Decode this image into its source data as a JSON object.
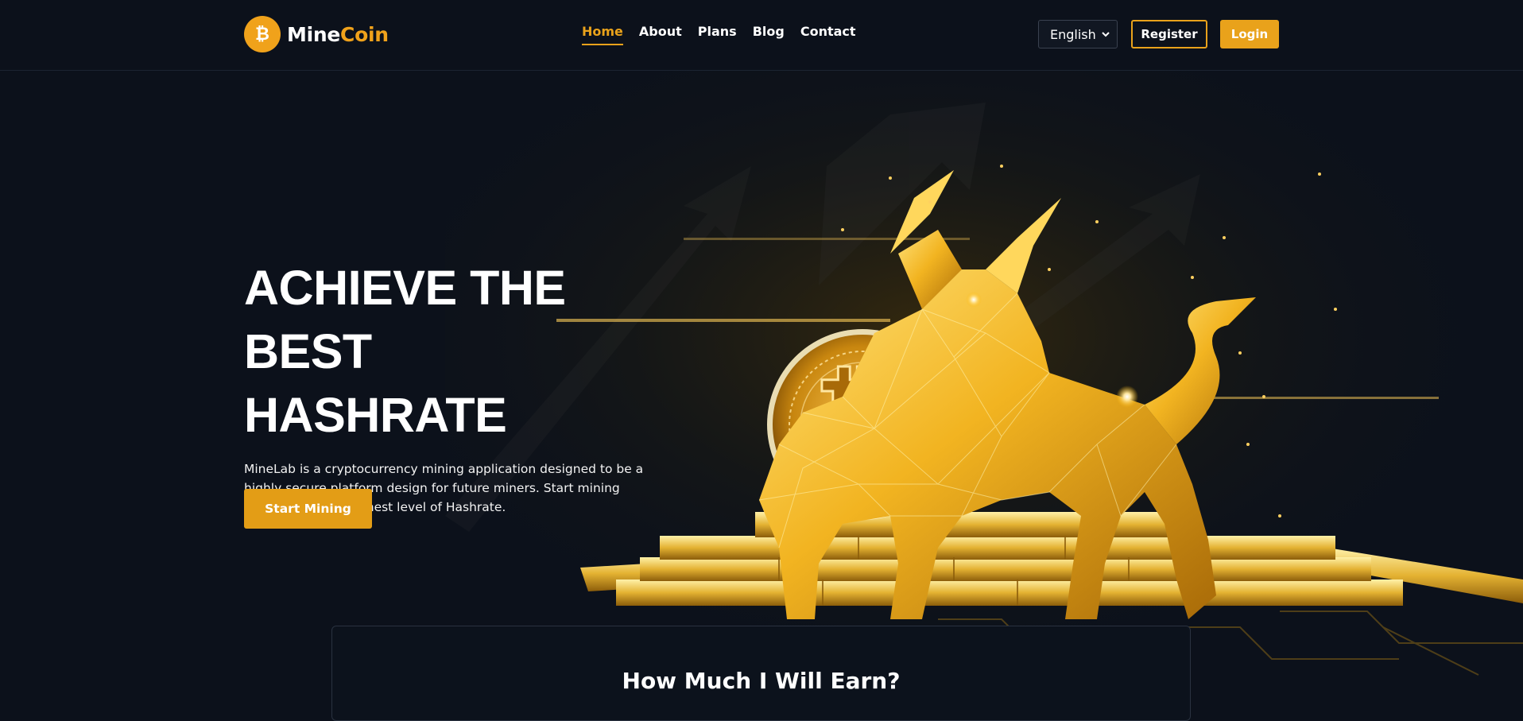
{
  "brand": {
    "name_primary": "Mine",
    "name_accent": "Coin",
    "logo_icon": "bitcoin-icon",
    "accent_color": "#e9a21b"
  },
  "nav": {
    "items": [
      {
        "label": "Home",
        "active": true
      },
      {
        "label": "About",
        "active": false
      },
      {
        "label": "Plans",
        "active": false
      },
      {
        "label": "Blog",
        "active": false
      },
      {
        "label": "Contact",
        "active": false
      }
    ]
  },
  "header": {
    "language": "English",
    "register_label": "Register",
    "login_label": "Login"
  },
  "hero": {
    "title_line1": "ACHIEVE THE BEST",
    "title_line2": "HASHRATE",
    "description": "MineLab is a cryptocurrency mining application designed to be a highly secure platform design for future miners. Start mining and achieve the highest level of Hashrate.",
    "cta_label": "Start Mining",
    "illustration": "golden-bull-with-bitcoin-and-gold-bars"
  },
  "earnings": {
    "title": "How Much I Will Earn?"
  }
}
